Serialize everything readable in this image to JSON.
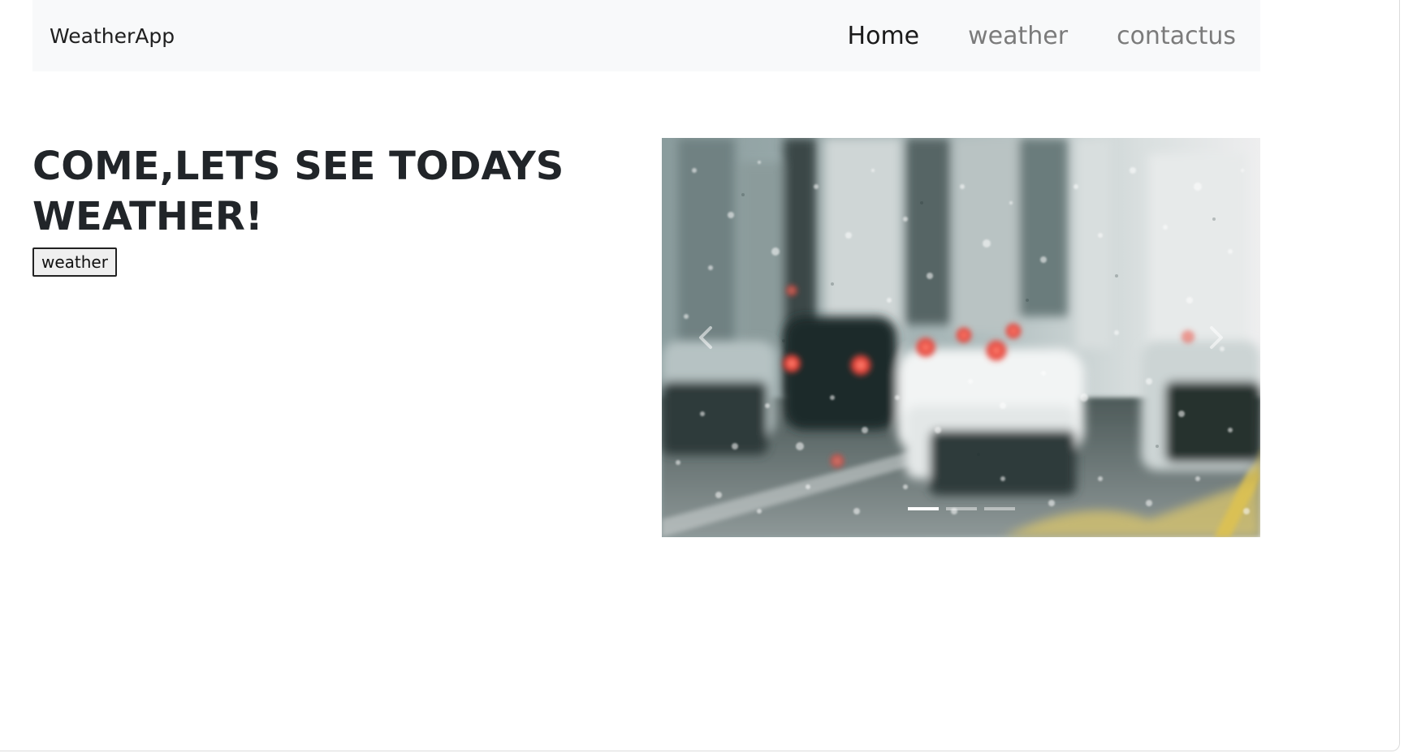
{
  "navbar": {
    "brand": "WeatherApp",
    "links": [
      {
        "label": "Home",
        "active": true
      },
      {
        "label": "weather",
        "active": false
      },
      {
        "label": "contactus",
        "active": false
      }
    ]
  },
  "hero": {
    "headline": "COME,LETS SEE TODAYS WEATHER!",
    "button_label": "weather"
  },
  "carousel": {
    "slide_count": 3,
    "active_slide": 1,
    "image_description_icon": "rainy-street-photo",
    "prev_icon": "chevron-left-icon",
    "next_icon": "chevron-right-icon"
  },
  "colors": {
    "navbar_bg": "#f8f9fa",
    "headline": "#212529",
    "nav_active": "#1a1a1a",
    "nav_inactive": "#7b7b7b"
  }
}
